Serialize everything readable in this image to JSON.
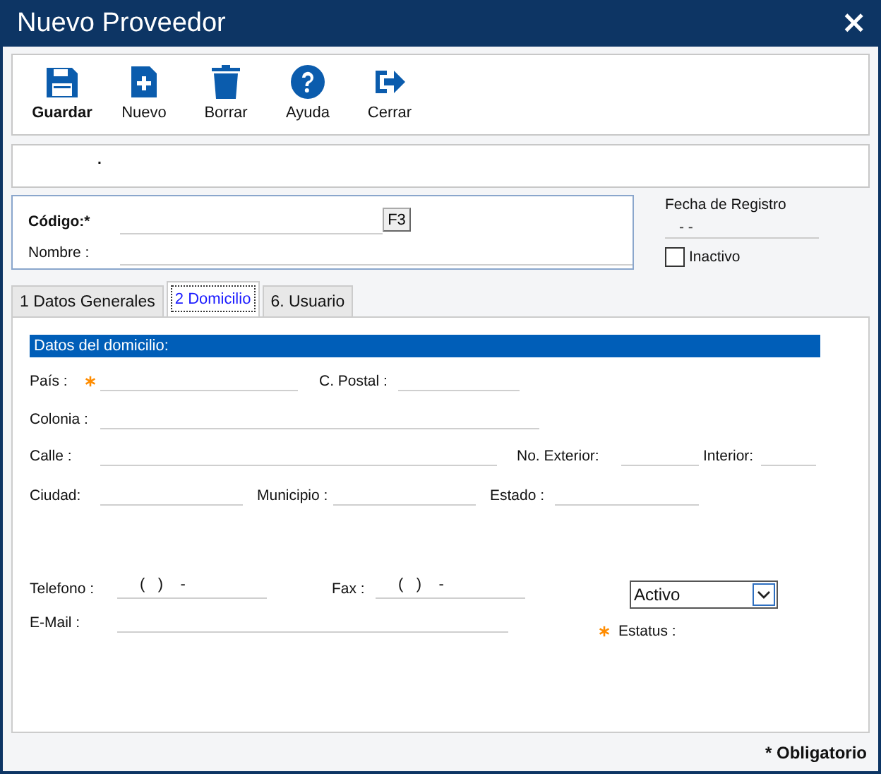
{
  "window": {
    "title": "Nuevo Proveedor",
    "close": "×"
  },
  "toolbar": [
    {
      "label": "Guardar",
      "kind": "save",
      "default": true
    },
    {
      "label": "Nuevo",
      "kind": "new",
      "default": false
    },
    {
      "label": "Borrar",
      "kind": "delete",
      "default": false
    },
    {
      "label": "Ayuda",
      "kind": "help",
      "default": false
    },
    {
      "label": "Cerrar",
      "kind": "exit",
      "default": false
    }
  ],
  "message_panel": {
    "text": "."
  },
  "header": {
    "code": {
      "label": "Código:*",
      "button": "F3"
    },
    "name": {
      "label": "Nombre :"
    }
  },
  "registration": {
    "label": "Fecha de Registro",
    "value": "- -"
  },
  "inactive": {
    "label": "Inactivo",
    "checked": false
  },
  "tabs": [
    {
      "label": "1 Datos Generales",
      "selected": false
    },
    {
      "label": "2 Domicilio",
      "selected": true
    },
    {
      "label": "6. Usuario",
      "selected": false
    }
  ],
  "address": {
    "title": "Datos del domicilio:",
    "rows": [
      [
        {
          "label": "País :",
          "required": true
        },
        {
          "label": "C. Postal :",
          "required": false
        }
      ],
      [
        {
          "label": "Colonia :",
          "required": false
        }
      ],
      [
        {
          "label": "Calle :",
          "required": false
        },
        {
          "label": "No. Exterior:",
          "required": false
        },
        {
          "label": "Interior:",
          "required": false
        }
      ],
      [
        {
          "label": "Ciudad:",
          "required": false
        },
        {
          "label": "Municipio :",
          "required": false
        },
        {
          "label": "Estado :",
          "required": false
        }
      ]
    ],
    "contact_rows": [
      [
        {
          "label": "Telefono :",
          "required": false,
          "value": "(   )    -"
        },
        {
          "label": "Fax :",
          "required": false,
          "value": "(   )    -"
        }
      ],
      [
        {
          "label": "E-Mail :",
          "required": false
        }
      ]
    ]
  },
  "status": {
    "label": "Estatus :",
    "value": "Activo",
    "required": true
  },
  "footer": "* Obligatorio"
}
